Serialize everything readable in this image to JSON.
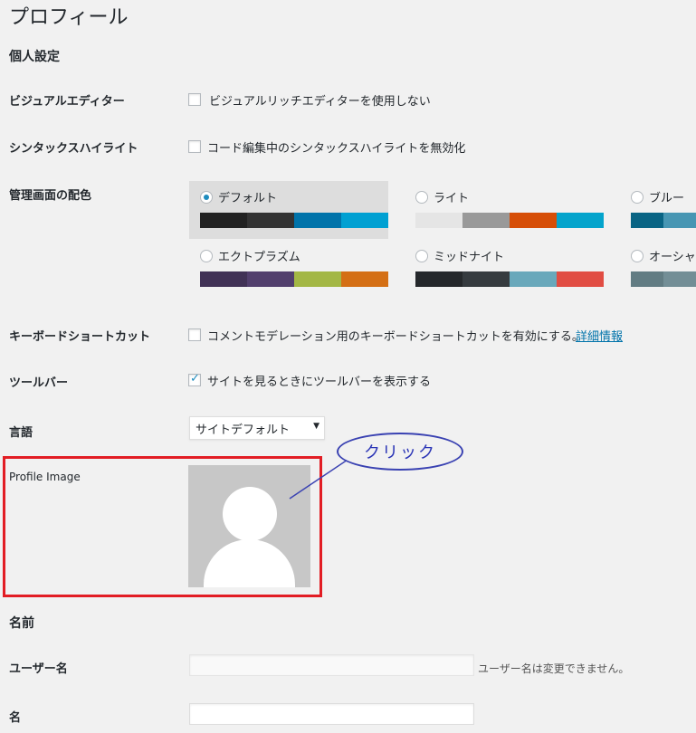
{
  "page_title": "プロフィール",
  "personal_options": {
    "title": "個人設定",
    "visual_editor": {
      "label": "ビジュアルエディター",
      "checkbox_label": "ビジュアルリッチエディターを使用しない",
      "checked": false
    },
    "syntax_highlight": {
      "label": "シンタックスハイライト",
      "checkbox_label": "コード編集中のシンタックスハイライトを無効化",
      "checked": false
    },
    "admin_color": {
      "label": "管理画面の配色",
      "schemes": [
        {
          "name": "デフォルト",
          "selected": true,
          "colors": [
            "#222222",
            "#333333",
            "#0073aa",
            "#00a0d2"
          ]
        },
        {
          "name": "ライト",
          "selected": false,
          "colors": [
            "#e5e5e5",
            "#999999",
            "#d64e07",
            "#04a4cc"
          ]
        },
        {
          "name": "ブルー",
          "selected": false,
          "colors": [
            "#096484",
            "#4796b3"
          ]
        },
        {
          "name": "エクトプラズム",
          "selected": false,
          "colors": [
            "#413256",
            "#523f6d",
            "#a3b745",
            "#d46f15"
          ]
        },
        {
          "name": "ミッドナイト",
          "selected": false,
          "colors": [
            "#25282b",
            "#363b3f",
            "#69a8bb",
            "#e14d43"
          ]
        },
        {
          "name": "オーシャ",
          "selected": false,
          "colors": [
            "#627c83",
            "#738e96"
          ]
        }
      ]
    },
    "keyboard_shortcuts": {
      "label": "キーボードショートカット",
      "checkbox_label": "コメントモデレーション用のキーボードショートカットを有効にする。",
      "link": "詳細情報",
      "checked": false
    },
    "toolbar": {
      "label": "ツールバー",
      "checkbox_label": "サイトを見るときにツールバーを表示する",
      "checked": true
    },
    "language": {
      "label": "言語",
      "selected": "サイトデフォルト"
    }
  },
  "profile_image": {
    "label": "Profile Image"
  },
  "annotation": {
    "callout_text": "クリック"
  },
  "name_section": {
    "title": "名前",
    "username": {
      "label": "ユーザー名",
      "value": "",
      "description": "ユーザー名は変更できません。"
    },
    "first_name": {
      "label": "名",
      "value": ""
    }
  },
  "icons": {
    "checkbox_checked": "checkmark-icon",
    "select_arrow": "caret-down-icon",
    "avatar": "user-silhouette-icon"
  },
  "colors": {
    "accent": "#0073aa",
    "highlight_box": "#e21d24",
    "callout": "#3a42b2"
  }
}
